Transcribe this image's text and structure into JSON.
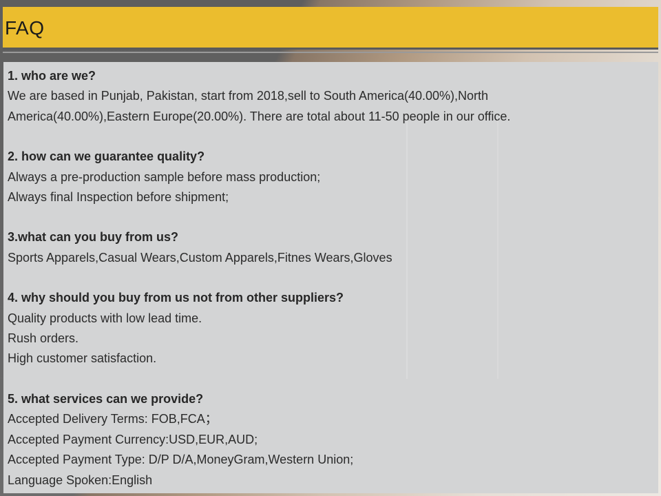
{
  "header": {
    "title": "FAQ"
  },
  "faq": [
    {
      "question": "1. who are we?",
      "answer_lines": [
        "We are based in Punjab, Pakistan, start from 2018,sell to South America(40.00%),North America(40.00%),Eastern Europe(20.00%). There are total about 11-50 people in our office."
      ]
    },
    {
      "question": "2. how can we guarantee quality?",
      "answer_lines": [
        "Always a pre-production sample before mass production;",
        "Always final Inspection before shipment;"
      ]
    },
    {
      "question": "3.what can you buy from us?",
      "answer_lines": [
        "Sports Apparels,Casual Wears,Custom Apparels,Fitnes Wears,Gloves"
      ]
    },
    {
      "question": "4. why should you buy from us not from other suppliers?",
      "answer_lines": [
        "Quality products with low lead time.",
        "Rush orders.",
        "High customer satisfaction."
      ]
    },
    {
      "question": "5. what services can we provide?",
      "answer_lines": [
        "Accepted Delivery Terms: FOB,FCA；",
        "Accepted Payment Currency:USD,EUR,AUD;",
        "Accepted Payment Type: D/P D/A,MoneyGram,Western Union;",
        "Language Spoken:English"
      ]
    }
  ]
}
